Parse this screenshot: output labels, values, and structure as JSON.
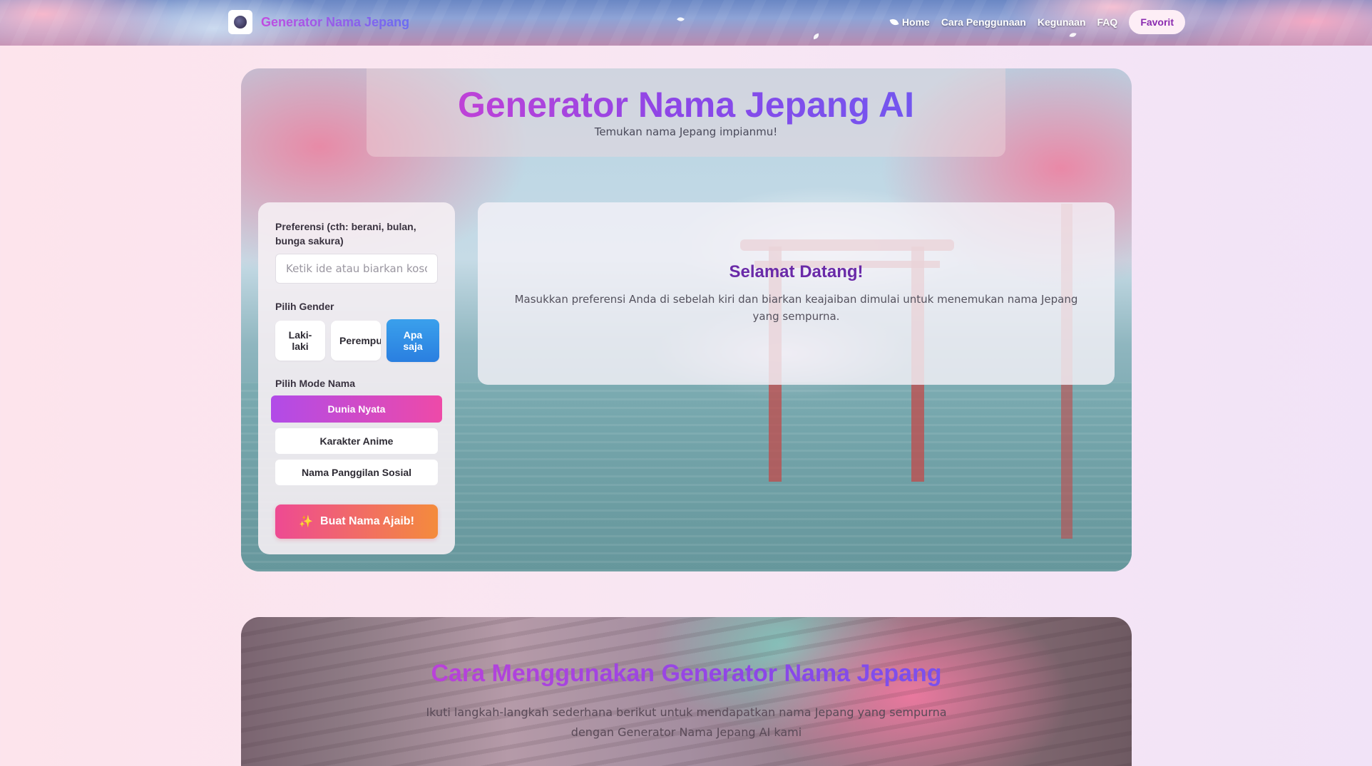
{
  "navbar": {
    "brand_name": "Generator Nama Jepang",
    "links": [
      "Home",
      "Cara Penggunaan",
      "Kegunaan",
      "FAQ"
    ],
    "favorite_label": "Favorit"
  },
  "hero": {
    "title": "Generator Nama Jepang AI",
    "subtitle": "Temukan nama Jepang impianmu!"
  },
  "form": {
    "preference_label": "Preferensi (cth: berani, bulan, bunga sakura)",
    "preference_placeholder": "Ketik ide atau biarkan kosong",
    "preference_value": "",
    "gender_label": "Pilih Gender",
    "gender_options": [
      "Laki-laki",
      "Perempuan",
      "Apa saja"
    ],
    "gender_selected": "Apa saja",
    "mode_label": "Pilih Mode Nama",
    "mode_options": [
      "Dunia Nyata",
      "Karakter Anime",
      "Nama Panggilan Sosial"
    ],
    "mode_selected": "Dunia Nyata",
    "generate_label": "Buat Nama Ajaib!"
  },
  "welcome": {
    "title": "Selamat Datang!",
    "text": "Masukkan preferensi Anda di sebelah kiri dan biarkan keajaiban dimulai untuk menemukan nama Jepang yang sempurna."
  },
  "how_to": {
    "title": "Cara Menggunakan Generator Nama Jepang",
    "subtitle": "Ikuti langkah-langkah sederhana berikut untuk mendapatkan nama Jepang yang sempurna dengan Generator Nama Jepang AI kami"
  },
  "colors": {
    "accent_purple": "#8a47e8",
    "accent_pink": "#ee4aa8",
    "active_gender": "#2a7fe0",
    "generate_gradient_start": "#ee4a93",
    "generate_gradient_end": "#f48b3c"
  }
}
